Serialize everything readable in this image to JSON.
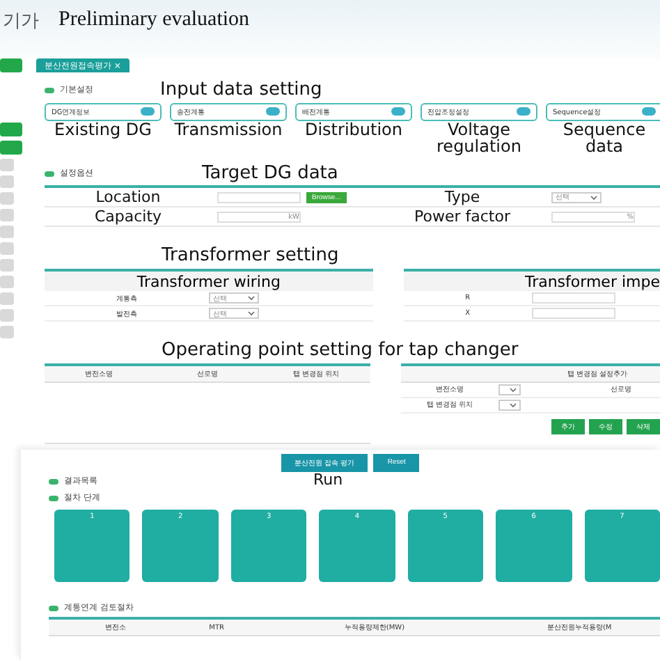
{
  "header": {
    "logo": "기가",
    "title": "Preliminary evaluation"
  },
  "tab": {
    "label": "분산전원접속평가",
    "close": "×",
    "selected": true
  },
  "basic": {
    "heading": "기본설정",
    "annotation": "Input data setting",
    "cards": [
      {
        "label": "DG연계정보",
        "caption": "Existing DG"
      },
      {
        "label": "송전계통",
        "caption": "Transmission"
      },
      {
        "label": "배전계통",
        "caption": "Distribution"
      },
      {
        "label": "전압조정설정",
        "caption": "Voltage regulation"
      },
      {
        "label": "Sequence설정",
        "caption": "Sequence data"
      }
    ]
  },
  "options": {
    "heading": "설정옵션"
  },
  "target": {
    "annotation": "Target DG data",
    "rows": [
      [
        {
          "label": "Location",
          "kind": "browse",
          "button": "Browse..."
        },
        {
          "label": "Type",
          "kind": "select",
          "value": "선택"
        }
      ],
      [
        {
          "label": "Capacity",
          "kind": "unit",
          "unit": "kW"
        },
        {
          "label": "Power factor",
          "kind": "unit",
          "unit": "%"
        }
      ]
    ]
  },
  "transformer": {
    "annotation": "Transformer setting",
    "wiring": {
      "title": "Transformer wiring",
      "rows": [
        {
          "label": "계통측",
          "value": "선택"
        },
        {
          "label": "발전측",
          "value": "선택"
        }
      ]
    },
    "impedance": {
      "title": "Transformer impe",
      "rows": [
        {
          "label": "R"
        },
        {
          "label": "X"
        }
      ]
    }
  },
  "tap": {
    "annotation": "Operating point setting for tap changer",
    "columns": [
      "변전소명",
      "선로명",
      "탭 변경점 위치"
    ],
    "form": {
      "title": "탭 변경점 설정추가",
      "rows": [
        {
          "label": "변전소명",
          "extra": "선로명"
        },
        {
          "label": "탭 변경점 위치"
        }
      ],
      "buttons": [
        "추가",
        "수정",
        "삭제"
      ]
    }
  },
  "actions": {
    "buttons": [
      "분산전원 접속 평가",
      "Reset"
    ],
    "annotation": "Run"
  },
  "results": {
    "heading": "결과목록",
    "steps_heading": "절차 단계",
    "steps": [
      "1",
      "2",
      "3",
      "4",
      "5",
      "6",
      "7"
    ],
    "table_heading": "계통연계 검토절차",
    "columns": [
      "변전소",
      "MTR",
      "누적용량제한(MW)",
      "분산전원누적용량(M"
    ]
  }
}
